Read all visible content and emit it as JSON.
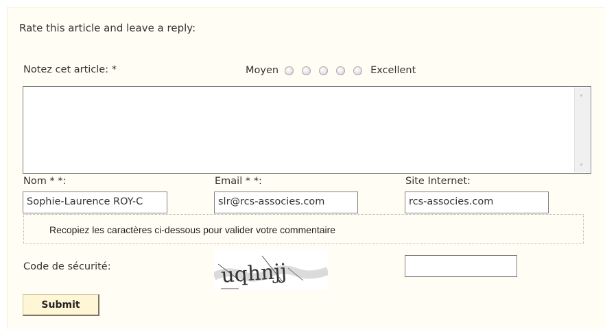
{
  "form": {
    "heading": "Rate this article and leave a reply:",
    "rating": {
      "label": "Notez cet article: *",
      "low_label": "Moyen",
      "high_label": "Excellent",
      "options": 5
    },
    "comment_value": "",
    "fields": {
      "name": {
        "label": "Nom * *:",
        "value": "Sophie-Laurence ROY-C"
      },
      "email": {
        "label": "Email * *:",
        "value": "slr@rcs-associes.com"
      },
      "website": {
        "label": "Site Internet:",
        "value": "rcs-associes.com"
      }
    },
    "captcha": {
      "instruction": "Recopiez les caractères ci-dessous pour valider votre commentaire",
      "label": "Code de sécurité:",
      "image_text": "uqhnjj",
      "input_value": ""
    },
    "submit_label": "Submit"
  }
}
